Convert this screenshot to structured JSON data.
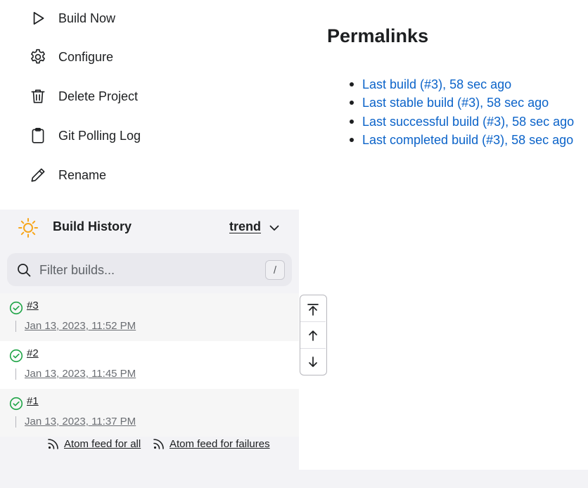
{
  "tasks": [
    {
      "label": "Build Now",
      "icon": "play-icon"
    },
    {
      "label": "Configure",
      "icon": "gear-icon"
    },
    {
      "label": "Delete Project",
      "icon": "trash-icon"
    },
    {
      "label": "Git Polling Log",
      "icon": "clipboard-icon"
    },
    {
      "label": "Rename",
      "icon": "pencil-icon"
    }
  ],
  "build_history": {
    "title": "Build History",
    "trend_label": "trend",
    "filter_placeholder": "Filter builds...",
    "filter_shortcut": "/",
    "builds": [
      {
        "number": "#3",
        "date": "Jan 13, 2023, 11:52 PM",
        "status": "success"
      },
      {
        "number": "#2",
        "date": "Jan 13, 2023, 11:45 PM",
        "status": "success"
      },
      {
        "number": "#1",
        "date": "Jan 13, 2023, 11:37 PM",
        "status": "success"
      }
    ],
    "feed_all": "Atom feed for all",
    "feed_failures": "Atom feed for failures"
  },
  "permalinks": {
    "title": "Permalinks",
    "items": [
      "Last build (#3), 58 sec ago",
      "Last stable build (#3), 58 sec ago",
      "Last successful build (#3), 58 sec ago",
      "Last completed build (#3), 58 sec ago"
    ]
  },
  "colors": {
    "link": "#0b63c9",
    "success": "#1ea446",
    "sun": "#f7a61c",
    "panel": "#f3f3f6"
  }
}
